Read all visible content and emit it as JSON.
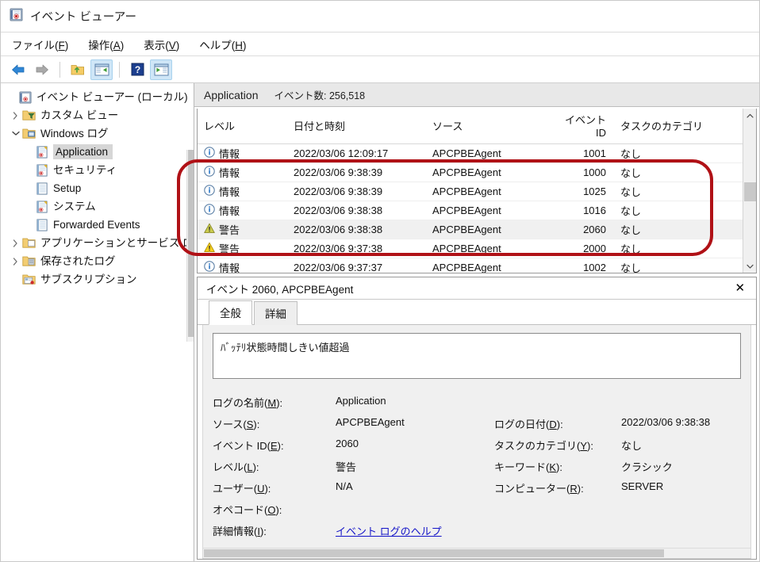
{
  "window": {
    "title": "イベント ビューアー",
    "icon": "event-viewer-icon"
  },
  "menu": {
    "items": [
      {
        "label": "ファイル(F)",
        "text": "ファイル(",
        "accel": "F",
        "tail": ")"
      },
      {
        "label": "操作(A)",
        "text": "操作(",
        "accel": "A",
        "tail": ")"
      },
      {
        "label": "表示(V)",
        "text": "表示(",
        "accel": "V",
        "tail": ")"
      },
      {
        "label": "ヘルプ(H)",
        "text": "ヘルプ(",
        "accel": "H",
        "tail": ")"
      }
    ]
  },
  "toolbar": {
    "buttons": [
      {
        "name": "back-arrow-icon",
        "active": false
      },
      {
        "name": "forward-arrow-icon",
        "active": false
      },
      {
        "name": "up-folder-icon",
        "active": false
      },
      {
        "name": "show-console-tree-icon",
        "active": true
      },
      {
        "name": "help-icon",
        "active": false
      },
      {
        "name": "show-action-pane-icon",
        "active": true
      }
    ]
  },
  "sidebar": {
    "items": [
      {
        "label": "イベント ビューアー (ローカル)",
        "indent": 0,
        "expander": "none",
        "icon": "event-viewer-icon",
        "selected": false
      },
      {
        "label": "カスタム ビュー",
        "indent": 1,
        "expander": "closed",
        "icon": "custom-view-folder-icon",
        "selected": false
      },
      {
        "label": "Windows ログ",
        "indent": 1,
        "expander": "open",
        "icon": "windows-logs-folder-icon",
        "selected": false
      },
      {
        "label": "Application",
        "indent": 2,
        "expander": "none",
        "icon": "log-badge-icon",
        "selected": true
      },
      {
        "label": "セキュリティ",
        "indent": 2,
        "expander": "none",
        "icon": "log-badge-icon",
        "selected": false
      },
      {
        "label": "Setup",
        "indent": 2,
        "expander": "none",
        "icon": "log-plain-icon",
        "selected": false
      },
      {
        "label": "システム",
        "indent": 2,
        "expander": "none",
        "icon": "log-badge-icon",
        "selected": false
      },
      {
        "label": "Forwarded Events",
        "indent": 2,
        "expander": "none",
        "icon": "log-plain-icon",
        "selected": false
      },
      {
        "label": "アプリケーションとサービス ログ",
        "indent": 1,
        "expander": "closed",
        "icon": "app-services-folder-icon",
        "selected": false
      },
      {
        "label": "保存されたログ",
        "indent": 1,
        "expander": "closed",
        "icon": "saved-logs-folder-icon",
        "selected": false
      },
      {
        "label": "サブスクリプション",
        "indent": 1,
        "expander": "none",
        "icon": "subscriptions-icon",
        "selected": false
      }
    ]
  },
  "list": {
    "caption": "Application",
    "count_label": "イベント数: 256,518",
    "columns": [
      "レベル",
      "日付と時刻",
      "ソース",
      "イベント ID",
      "タスクのカテゴリ"
    ],
    "rows": [
      {
        "level": "情報",
        "level_icon": "information-icon",
        "datetime": "2022/03/06 12:09:17",
        "source": "APCPBEAgent",
        "event_id": "1001",
        "category": "なし",
        "highlighted": false
      },
      {
        "level": "情報",
        "level_icon": "information-icon",
        "datetime": "2022/03/06 9:38:39",
        "source": "APCPBEAgent",
        "event_id": "1000",
        "category": "なし",
        "highlighted": false
      },
      {
        "level": "情報",
        "level_icon": "information-icon",
        "datetime": "2022/03/06 9:38:39",
        "source": "APCPBEAgent",
        "event_id": "1025",
        "category": "なし",
        "highlighted": false
      },
      {
        "level": "情報",
        "level_icon": "information-icon",
        "datetime": "2022/03/06 9:38:38",
        "source": "APCPBEAgent",
        "event_id": "1016",
        "category": "なし",
        "highlighted": false
      },
      {
        "level": "警告",
        "level_icon": "warning-icon",
        "datetime": "2022/03/06 9:38:38",
        "source": "APCPBEAgent",
        "event_id": "2060",
        "category": "なし",
        "highlighted": true
      },
      {
        "level": "警告",
        "level_icon": "warning-icon",
        "datetime": "2022/03/06 9:37:38",
        "source": "APCPBEAgent",
        "event_id": "2000",
        "category": "なし",
        "highlighted": false
      },
      {
        "level": "情報",
        "level_icon": "information-icon",
        "datetime": "2022/03/06 9:37:37",
        "source": "APCPBEAgent",
        "event_id": "1002",
        "category": "なし",
        "highlighted": false
      }
    ]
  },
  "detail": {
    "header_title": "イベント 2060, APCPBEAgent",
    "close_glyph": "✕",
    "tabs": [
      {
        "label": "全般",
        "active": true
      },
      {
        "label": "詳細",
        "active": false
      }
    ],
    "message": "ﾊﾞｯﾃﾘ状態時間しきい値超過",
    "fields_left": [
      {
        "label": "ログの名前(M):",
        "text": "ログの名前(",
        "accel": "M",
        "tail": "):",
        "value": "Application"
      },
      {
        "label": "ソース(S):",
        "text": "ソース(",
        "accel": "S",
        "tail": "):",
        "value": "APCPBEAgent"
      },
      {
        "label": "イベント ID(E):",
        "text": "イベント ID(",
        "accel": "E",
        "tail": "):",
        "value": "2060"
      },
      {
        "label": "レベル(L):",
        "text": "レベル(",
        "accel": "L",
        "tail": "):",
        "value": "警告"
      },
      {
        "label": "ユーザー(U):",
        "text": "ユーザー(",
        "accel": "U",
        "tail": "):",
        "value": "N/A"
      },
      {
        "label": "オペコード(O):",
        "text": "オペコード(",
        "accel": "O",
        "tail": "):",
        "value": ""
      },
      {
        "label": "詳細情報(I):",
        "text": "詳細情報(",
        "accel": "I",
        "tail": "):",
        "value": "イベント ログのヘルプ"
      }
    ],
    "fields_right": [
      {
        "label": "",
        "text": "",
        "accel": "",
        "tail": "",
        "value": ""
      },
      {
        "label": "ログの日付(D):",
        "text": "ログの日付(",
        "accel": "D",
        "tail": "):",
        "value": "2022/03/06 9:38:38"
      },
      {
        "label": "タスクのカテゴリ(Y):",
        "text": "タスクのカテゴリ(",
        "accel": "Y",
        "tail": "):",
        "value": "なし"
      },
      {
        "label": "キーワード(K):",
        "text": "キーワード(",
        "accel": "K",
        "tail": "):",
        "value": "クラシック"
      },
      {
        "label": "コンピューター(R):",
        "text": "コンピューター(",
        "accel": "R",
        "tail": "):",
        "value": "SERVER"
      },
      {
        "label": "",
        "text": "",
        "accel": "",
        "tail": "",
        "value": ""
      },
      {
        "label": "",
        "text": "",
        "accel": "",
        "tail": "",
        "value": ""
      }
    ],
    "help_link": "イベント ログのヘルプ"
  },
  "annotation": {
    "shape": "rounded-rectangle",
    "color": "#b01116",
    "highlights_rows": [
      "1000",
      "1025",
      "1016",
      "2060",
      "2000"
    ]
  },
  "colors": {
    "annotation_red": "#b01116",
    "selection_gray": "#d6d6d6",
    "caption_bg": "#e8e8e8",
    "link_blue": "#1414c8",
    "warning_yellow": "#f5c518",
    "info_blue": "#2a72c8"
  }
}
